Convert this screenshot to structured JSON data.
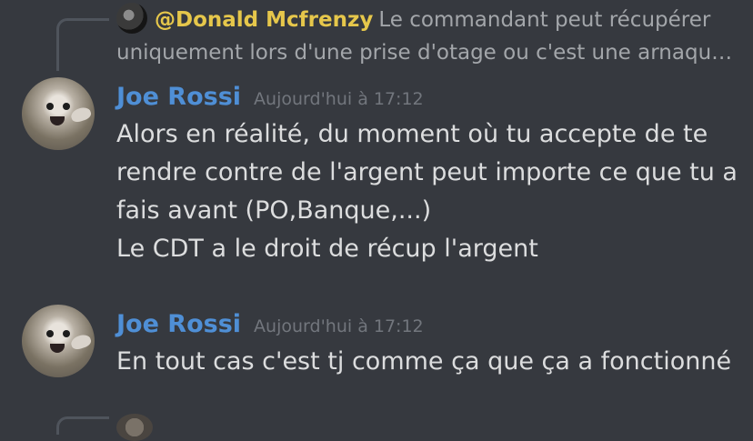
{
  "reply": {
    "mention": "@Donald Mcfrenzy",
    "preview_line1": "Le commandant peut récupérer",
    "preview_line2": "uniquement lors d'une prise d'otage ou c'est une arnaqu…"
  },
  "messages": [
    {
      "author": "Joe Rossi",
      "timestamp": "Aujourd'hui à 17:12",
      "lines": [
        "Alors en réalité, du moment où tu accepte de te",
        "rendre contre de l'argent peut importe ce que tu a",
        "fais avant (PO,Banque,...)",
        "Le CDT a le droit de récup l'argent"
      ]
    },
    {
      "author": "Joe Rossi",
      "timestamp": "Aujourd'hui à 17:12",
      "lines": [
        "En tout cas c'est tj comme ça que ça a fonctionné"
      ]
    }
  ],
  "colors": {
    "background": "#36393f",
    "author": "#4f8fd6",
    "mention": "#e6c74b",
    "text": "#dcddde",
    "muted": "#72767d"
  },
  "icons": {
    "reply_avatar": "reply-avatar-icon",
    "user_avatar": "seal-avatar-icon"
  }
}
